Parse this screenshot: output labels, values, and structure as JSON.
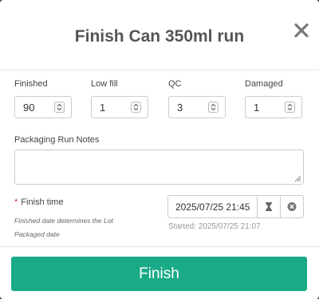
{
  "modal": {
    "title": "Finish Can 350ml run",
    "close_icon": "close-icon"
  },
  "counts": [
    {
      "label": "Finished",
      "value": "90"
    },
    {
      "label": "Low fill",
      "value": "1"
    },
    {
      "label": "QC",
      "value": "3"
    },
    {
      "label": "Damaged",
      "value": "1"
    }
  ],
  "notes": {
    "label": "Packaging Run Notes",
    "value": ""
  },
  "finish_time": {
    "required_marker": "*",
    "label": "Finish time",
    "hint": "Finished date determines the Lot Packaged date",
    "value": "2025/07/25 21:45",
    "started": "Started: 2025/07/25 21:07",
    "picker_icon": "hourglass-icon",
    "clear_icon": "clear-icon"
  },
  "footer": {
    "finish_label": "Finish",
    "accent_color": "#1aaa87"
  }
}
